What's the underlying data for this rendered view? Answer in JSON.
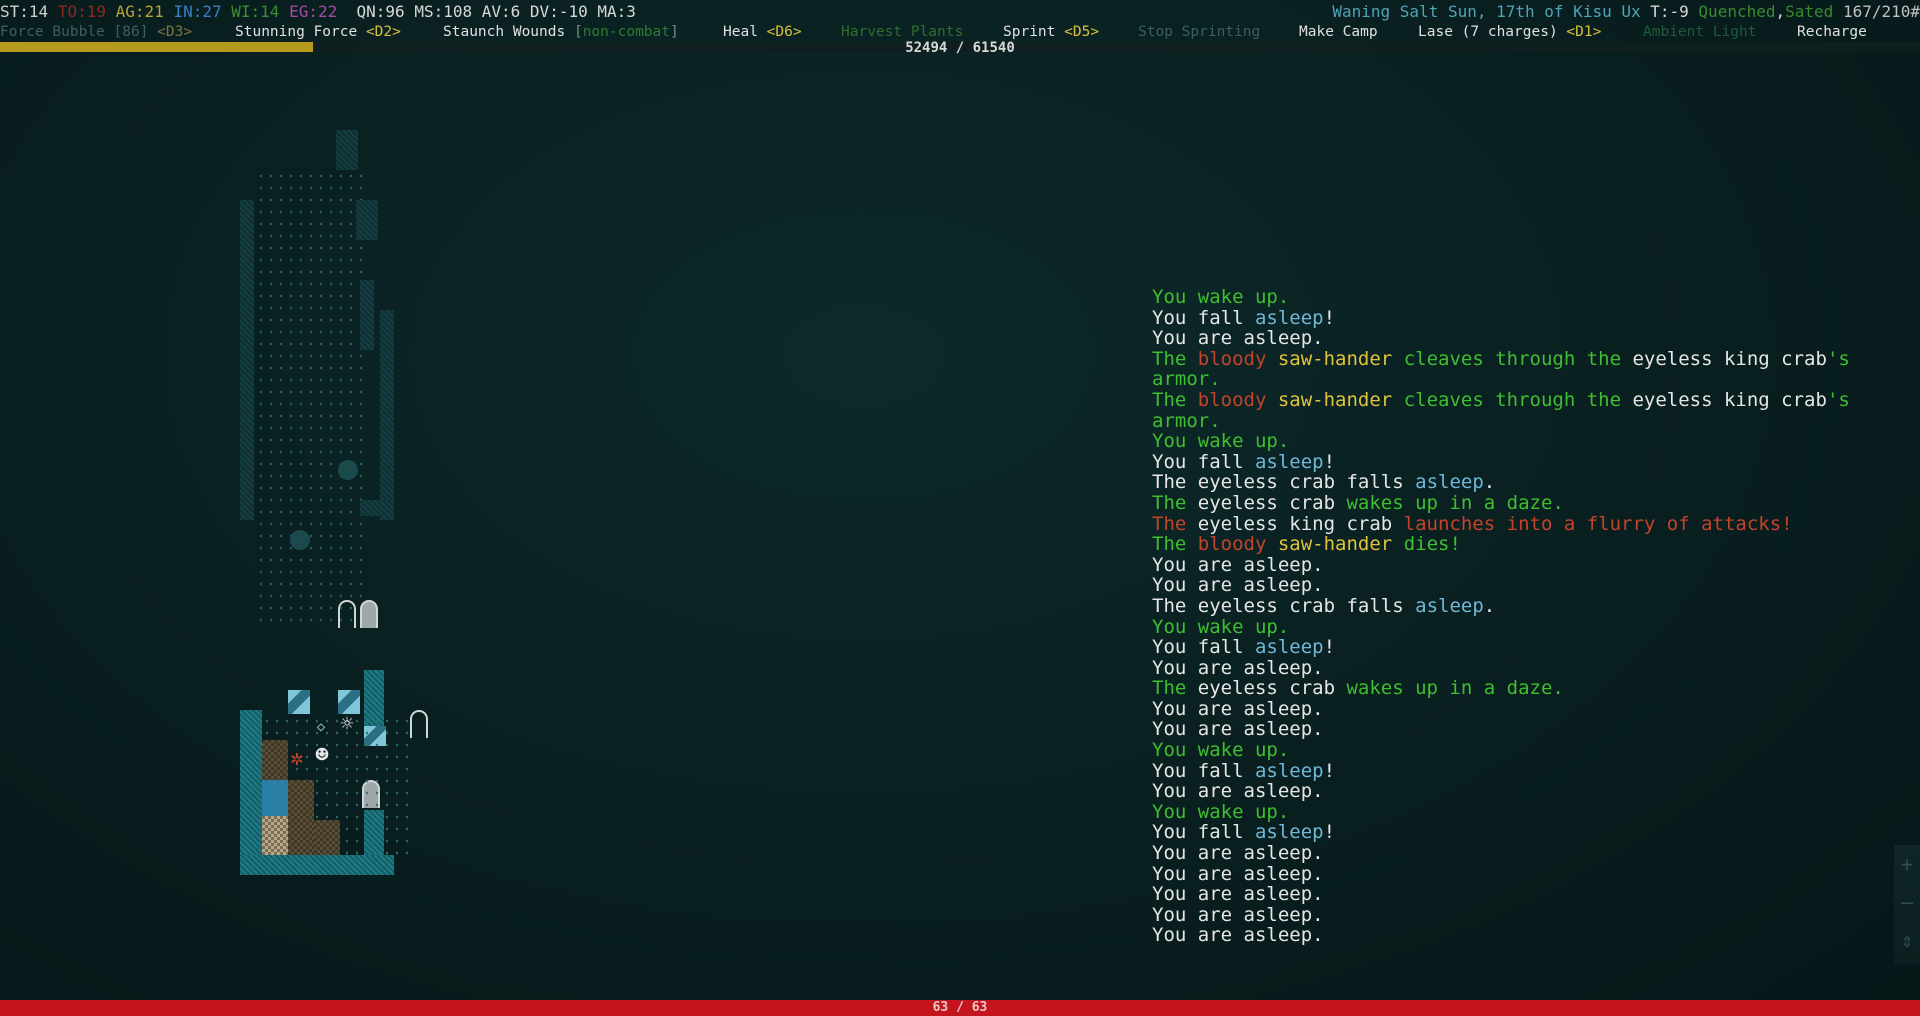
{
  "stats": {
    "st": "ST:14",
    "to": "TO:19",
    "ag": "AG:21",
    "in": "IN:27",
    "wi": "WI:14",
    "eg": "EG:22",
    "qn": "QN:96",
    "ms": "MS:108",
    "av": "AV:6",
    "dv": "DV:-10",
    "ma": "MA:3",
    "date": "Waning Salt Sun, 17th of Kisu Ux",
    "temp": "T:-9",
    "quenched": "Quenched",
    "comma": ",",
    "sated": "Sated",
    "weight": "167/210#"
  },
  "abilities": [
    {
      "label": "Force Bubble [86]",
      "key": "<D3>",
      "style": "dim"
    },
    {
      "label": "Stunning Force",
      "key": "<D2>",
      "style": "normal"
    },
    {
      "label": "Staunch Wounds",
      "key": "",
      "extra": "non-combat",
      "style": "normal"
    },
    {
      "label": "Heal",
      "key": "<D6>",
      "style": "normal"
    },
    {
      "label": "Harvest Plants",
      "key": "",
      "style": "green"
    },
    {
      "label": "Sprint",
      "key": "<D5>",
      "style": "normal"
    },
    {
      "label": "Stop Sprinting",
      "key": "",
      "style": "dim"
    },
    {
      "label": "Make Camp",
      "key": "",
      "style": "normal"
    },
    {
      "label": "Lase (7 charges)",
      "key": "<D1>",
      "style": "normal"
    },
    {
      "label": "Ambient Light",
      "key": "",
      "style": "dimgreen"
    },
    {
      "label": "Recharge",
      "key": "",
      "style": "normal"
    }
  ],
  "xp": {
    "text": "52494 / 61540",
    "fraction": 0.163
  },
  "hp": {
    "text": "63 / 63",
    "fraction": 1.0
  },
  "log": [
    [
      [
        "You wake up.",
        "green"
      ]
    ],
    [
      [
        "You fall ",
        "white"
      ],
      [
        "asleep",
        "blue"
      ],
      [
        "!",
        "white"
      ]
    ],
    [
      [
        "You are asleep.",
        "white"
      ]
    ],
    [
      [
        "The ",
        "green"
      ],
      [
        "bloody",
        "red"
      ],
      [
        " ",
        "green"
      ],
      [
        "saw-hander",
        "yellow"
      ],
      [
        " cleaves through the ",
        "green"
      ],
      [
        "eyeless king crab",
        "white"
      ],
      [
        "'s armor.",
        "green"
      ]
    ],
    [
      [
        "The ",
        "green"
      ],
      [
        "bloody",
        "red"
      ],
      [
        " ",
        "green"
      ],
      [
        "saw-hander",
        "yellow"
      ],
      [
        " cleaves through the ",
        "green"
      ],
      [
        "eyeless king crab",
        "white"
      ],
      [
        "'s armor.",
        "green"
      ]
    ],
    [
      [
        "You wake up.",
        "green"
      ]
    ],
    [
      [
        "You fall ",
        "white"
      ],
      [
        "asleep",
        "blue"
      ],
      [
        "!",
        "white"
      ]
    ],
    [
      [
        "The ",
        "white"
      ],
      [
        "eyeless crab",
        "white"
      ],
      [
        " falls ",
        "white"
      ],
      [
        "asleep",
        "blue"
      ],
      [
        ".",
        "white"
      ]
    ],
    [
      [
        "The ",
        "green"
      ],
      [
        "eyeless crab",
        "white"
      ],
      [
        " wakes up in a daze.",
        "green"
      ]
    ],
    [
      [
        "The ",
        "red"
      ],
      [
        "eyeless king crab",
        "white"
      ],
      [
        " launches into a flurry of attacks!",
        "red"
      ]
    ],
    [
      [
        "The ",
        "green"
      ],
      [
        "bloody",
        "red"
      ],
      [
        " ",
        "green"
      ],
      [
        "saw-hander",
        "yellow"
      ],
      [
        " dies!",
        "green"
      ]
    ],
    [
      [
        "You are asleep.",
        "white"
      ]
    ],
    [
      [
        "You are asleep.",
        "white"
      ]
    ],
    [
      [
        "The ",
        "white"
      ],
      [
        "eyeless crab",
        "white"
      ],
      [
        " falls ",
        "white"
      ],
      [
        "asleep",
        "blue"
      ],
      [
        ".",
        "white"
      ]
    ],
    [
      [
        "You wake up.",
        "green"
      ]
    ],
    [
      [
        "You fall ",
        "white"
      ],
      [
        "asleep",
        "blue"
      ],
      [
        "!",
        "white"
      ]
    ],
    [
      [
        "You are asleep.",
        "white"
      ]
    ],
    [
      [
        "The ",
        "green"
      ],
      [
        "eyeless crab",
        "white"
      ],
      [
        " wakes up in a daze.",
        "green"
      ]
    ],
    [
      [
        "You are asleep.",
        "white"
      ]
    ],
    [
      [
        "You are asleep.",
        "white"
      ]
    ],
    [
      [
        "You wake up.",
        "green"
      ]
    ],
    [
      [
        "You fall ",
        "white"
      ],
      [
        "asleep",
        "blue"
      ],
      [
        "!",
        "white"
      ]
    ],
    [
      [
        "You are asleep.",
        "white"
      ]
    ],
    [
      [
        "You wake up.",
        "green"
      ]
    ],
    [
      [
        "You fall ",
        "white"
      ],
      [
        "asleep",
        "blue"
      ],
      [
        "!",
        "white"
      ]
    ],
    [
      [
        "You are asleep.",
        "white"
      ]
    ],
    [
      [
        "You are asleep.",
        "white"
      ]
    ],
    [
      [
        "You are asleep.",
        "white"
      ]
    ],
    [
      [
        "You are asleep.",
        "white"
      ]
    ],
    [
      [
        "You are asleep.",
        "white"
      ]
    ]
  ],
  "side_controls": [
    "plus-icon",
    "minus-icon",
    "updown-arrow-icon"
  ]
}
